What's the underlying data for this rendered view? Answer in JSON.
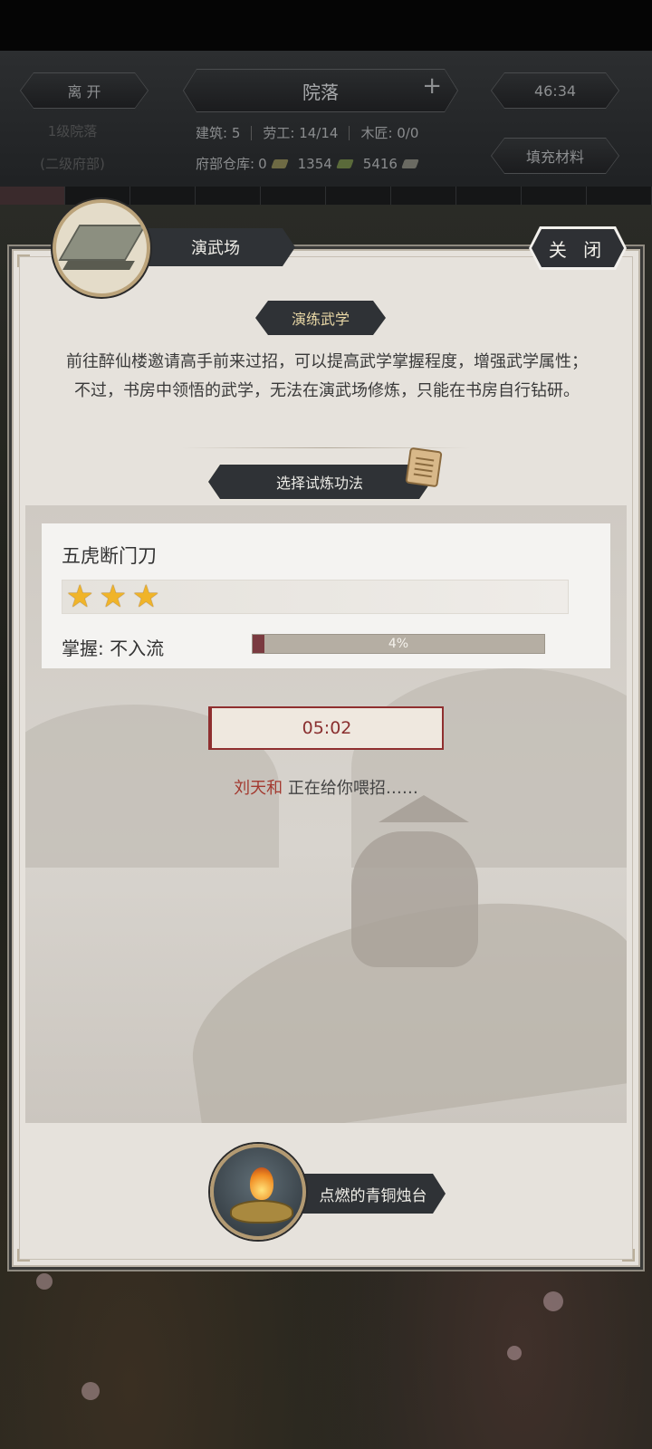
{
  "hud": {
    "leave_label": "离 开",
    "title": "院落",
    "timer": "46:34",
    "level": "1级院落",
    "sub_level": "(二级府部)",
    "buildings": "建筑: 5",
    "workers": "劳工: 14/14",
    "carpenters": "木匠: 0/0",
    "warehouse_label": "府部仓库:",
    "res1": "0",
    "res2": "1354",
    "res3": "5416",
    "fill_label": "填充材料"
  },
  "panel": {
    "title": "演武场",
    "close_label": "关 闭",
    "section_tag": "演练武学",
    "description": "前往醉仙楼邀请高手前来过招，可以提高武学掌握程度，增强武学属性；不过，书房中领悟的武学，无法在演武场修炼，只能在书房自行钻研。",
    "select_label": "选择试炼功法"
  },
  "skill": {
    "name": "五虎断门刀",
    "stars": 3,
    "mastery_label": "掌握: 不入流",
    "progress_percent": 4,
    "progress_text": "4%"
  },
  "training": {
    "timer": "05:02",
    "sparring_name": "刘天和",
    "sparring_text": "正在给你喂招……"
  },
  "item": {
    "label": "点燃的青铜烛台"
  },
  "colors": {
    "accent_red": "#8a2f2f",
    "star": "#f0b429",
    "panel_bg": "#e6e2dc"
  }
}
